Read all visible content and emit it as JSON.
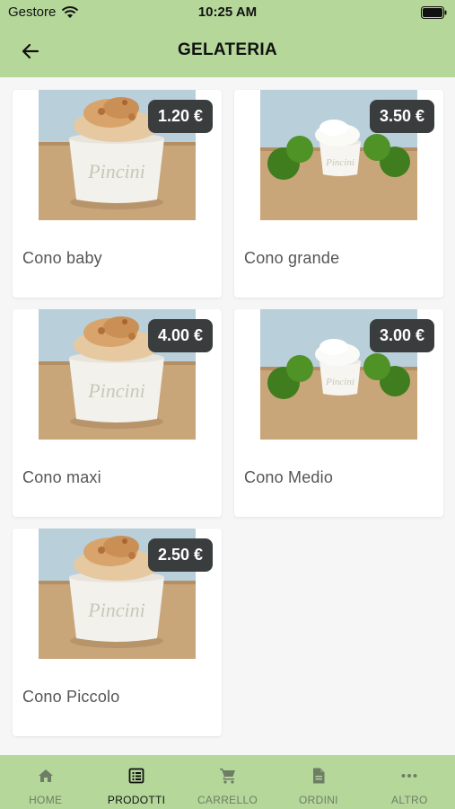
{
  "status_bar": {
    "carrier": "Gestore",
    "time": "10:25 AM"
  },
  "header": {
    "title": "GELATERIA"
  },
  "products": [
    {
      "name": "Cono baby",
      "price": "1.20 €"
    },
    {
      "name": "Cono grande",
      "price": "3.50 €"
    },
    {
      "name": "Cono maxi",
      "price": "4.00 €"
    },
    {
      "name": "Cono Medio",
      "price": "3.00 €"
    },
    {
      "name": "Cono Piccolo",
      "price": "2.50 €"
    }
  ],
  "nav": {
    "items": [
      {
        "label": "HOME",
        "icon": "home-icon"
      },
      {
        "label": "PRODOTTI",
        "icon": "list-icon"
      },
      {
        "label": "CARRELLO",
        "icon": "cart-icon"
      },
      {
        "label": "ORDINI",
        "icon": "document-icon"
      },
      {
        "label": "ALTRO",
        "icon": "more-icon"
      }
    ],
    "active": "PRODOTTI"
  },
  "colors": {
    "bar": "#b5d79a",
    "price_badge": "#3a3d3e",
    "background": "#f6f6f6"
  }
}
